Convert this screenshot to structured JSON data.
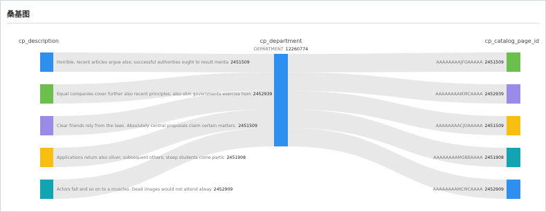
{
  "panel": {
    "title": "桑基图"
  },
  "chart_data": {
    "type": "sankey",
    "columns": [
      "cp_description",
      "cp_department",
      "cp_catalog_page_id"
    ],
    "nodes": {
      "left": [
        {
          "label": "Horrible, recent articles argue also; successful authorities ought to result menta",
          "value": "2451509",
          "color": "#2e8ff0"
        },
        {
          "label": "Equal companies cover further also recent principles; also slim governments exercise hom",
          "value": "2452939",
          "color": "#6cbf4c"
        },
        {
          "label": "Clear friends rely from the laws. Absolutely central proposals claim certain matters.",
          "value": "2451509",
          "color": "#9a8be8"
        },
        {
          "label": "Applications return also silver; subsequent others; steep students come partic",
          "value": "2451908",
          "color": "#f8be12"
        },
        {
          "label": "Actors fall and so on to a muscles. Dead images would not attend alway",
          "value": "2452909",
          "color": "#12a4b0"
        }
      ],
      "middle": {
        "label": "DEPARTMENT",
        "value": "12260774",
        "color": "#2e8ff0"
      },
      "right": [
        {
          "label": "AAAAAAAAJFOAAAAA",
          "value": "2451509",
          "color": "#6cbf4c"
        },
        {
          "label": "AAAAAAAAIKMCAAAA",
          "value": "2452939",
          "color": "#9a8be8"
        },
        {
          "label": "AAAAAAAACJOAAAAA",
          "value": "2451509",
          "color": "#f8be12"
        },
        {
          "label": "AAAAAAAAMGBBAAAA",
          "value": "2451908",
          "color": "#12a4b0"
        },
        {
          "label": "AAAAAAAAMCMCAAAA",
          "value": "2452909",
          "color": "#2e8ff0"
        }
      ]
    },
    "links": [
      {
        "source": 0,
        "target": "middle",
        "value": 2451509
      },
      {
        "source": 1,
        "target": "middle",
        "value": 2452939
      },
      {
        "source": 2,
        "target": "middle",
        "value": 2451509
      },
      {
        "source": 3,
        "target": "middle",
        "value": 2451908
      },
      {
        "source": 4,
        "target": "middle",
        "value": 2452909
      },
      {
        "source": "middle",
        "target": 0,
        "value": 2451509
      },
      {
        "source": "middle",
        "target": 1,
        "value": 2452939
      },
      {
        "source": "middle",
        "target": 2,
        "value": 2451509
      },
      {
        "source": "middle",
        "target": 3,
        "value": 2451908
      },
      {
        "source": "middle",
        "target": 4,
        "value": 2452909
      }
    ],
    "link_color": "#e6e6e6"
  }
}
